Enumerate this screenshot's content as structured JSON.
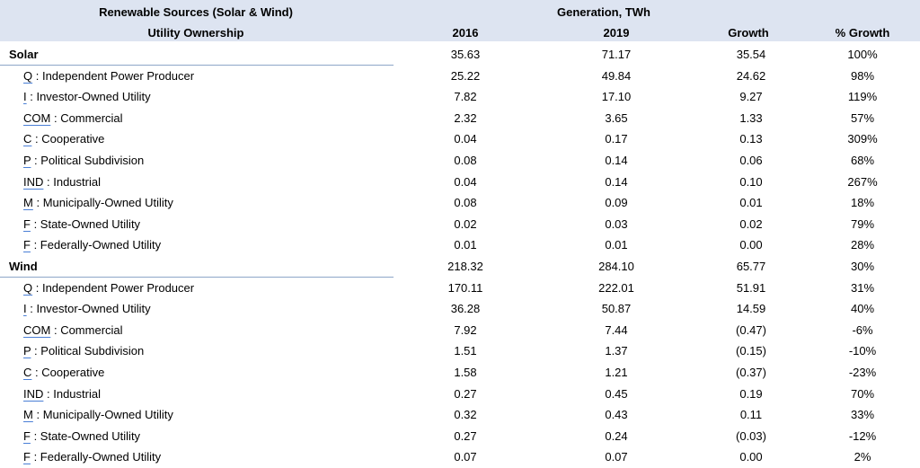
{
  "header": {
    "title_left": "Renewable Sources (Solar & Wind)",
    "title_right": "Generation, TWh",
    "subtitle_left": "Utility Ownership",
    "col_2016": "2016",
    "col_2019": "2019",
    "col_growth": "Growth",
    "col_pct": "% Growth"
  },
  "rows": [
    {
      "type": "group",
      "label": "Solar",
      "y2016": "35.63",
      "y2019": "71.17",
      "growth": "35.54",
      "pct": "100%"
    },
    {
      "type": "item",
      "code": "Q",
      "desc": "Independent Power Producer",
      "y2016": "25.22",
      "y2019": "49.84",
      "growth": "24.62",
      "pct": "98%"
    },
    {
      "type": "item",
      "code": "I",
      "desc": "Investor-Owned Utility",
      "y2016": "7.82",
      "y2019": "17.10",
      "growth": "9.27",
      "pct": "119%"
    },
    {
      "type": "item",
      "code": "COM",
      "desc": "Commercial",
      "y2016": "2.32",
      "y2019": "3.65",
      "growth": "1.33",
      "pct": "57%"
    },
    {
      "type": "item",
      "code": "C",
      "desc": "Cooperative",
      "y2016": "0.04",
      "y2019": "0.17",
      "growth": "0.13",
      "pct": "309%"
    },
    {
      "type": "item",
      "code": "P",
      "desc": "Political Subdivision",
      "y2016": "0.08",
      "y2019": "0.14",
      "growth": "0.06",
      "pct": "68%"
    },
    {
      "type": "item",
      "code": "IND",
      "desc": "Industrial",
      "y2016": "0.04",
      "y2019": "0.14",
      "growth": "0.10",
      "pct": "267%"
    },
    {
      "type": "item",
      "code": "M",
      "desc": "Municipally-Owned Utility",
      "y2016": "0.08",
      "y2019": "0.09",
      "growth": "0.01",
      "pct": "18%"
    },
    {
      "type": "item",
      "code": "F",
      "desc": "State-Owned Utility",
      "y2016": "0.02",
      "y2019": "0.03",
      "growth": "0.02",
      "pct": "79%"
    },
    {
      "type": "item",
      "code": "F",
      "desc": "Federally-Owned Utility",
      "y2016": "0.01",
      "y2019": "0.01",
      "growth": "0.00",
      "pct": "28%"
    },
    {
      "type": "group",
      "label": "Wind",
      "y2016": "218.32",
      "y2019": "284.10",
      "growth": "65.77",
      "pct": "30%"
    },
    {
      "type": "item",
      "code": "Q",
      "desc": "Independent Power Producer",
      "y2016": "170.11",
      "y2019": "222.01",
      "growth": "51.91",
      "pct": "31%"
    },
    {
      "type": "item",
      "code": "I",
      "desc": "Investor-Owned Utility",
      "y2016": "36.28",
      "y2019": "50.87",
      "growth": "14.59",
      "pct": "40%"
    },
    {
      "type": "item",
      "code": "COM",
      "desc": "Commercial",
      "y2016": "7.92",
      "y2019": "7.44",
      "growth": "(0.47)",
      "pct": "-6%"
    },
    {
      "type": "item",
      "code": "P",
      "desc": "Political Subdivision",
      "y2016": "1.51",
      "y2019": "1.37",
      "growth": "(0.15)",
      "pct": "-10%"
    },
    {
      "type": "item",
      "code": "C",
      "desc": "Cooperative",
      "y2016": "1.58",
      "y2019": "1.21",
      "growth": "(0.37)",
      "pct": "-23%"
    },
    {
      "type": "item",
      "code": "IND",
      "desc": "Industrial",
      "y2016": "0.27",
      "y2019": "0.45",
      "growth": "0.19",
      "pct": "70%"
    },
    {
      "type": "item",
      "code": "M",
      "desc": "Municipally-Owned Utility",
      "y2016": "0.32",
      "y2019": "0.43",
      "growth": "0.11",
      "pct": "33%"
    },
    {
      "type": "item",
      "code": "F",
      "desc": "State-Owned Utility",
      "y2016": "0.27",
      "y2019": "0.24",
      "growth": "(0.03)",
      "pct": "-12%"
    },
    {
      "type": "item",
      "code": "F",
      "desc": "Federally-Owned Utility",
      "y2016": "0.07",
      "y2019": "0.07",
      "growth": "0.00",
      "pct": "2%"
    }
  ]
}
